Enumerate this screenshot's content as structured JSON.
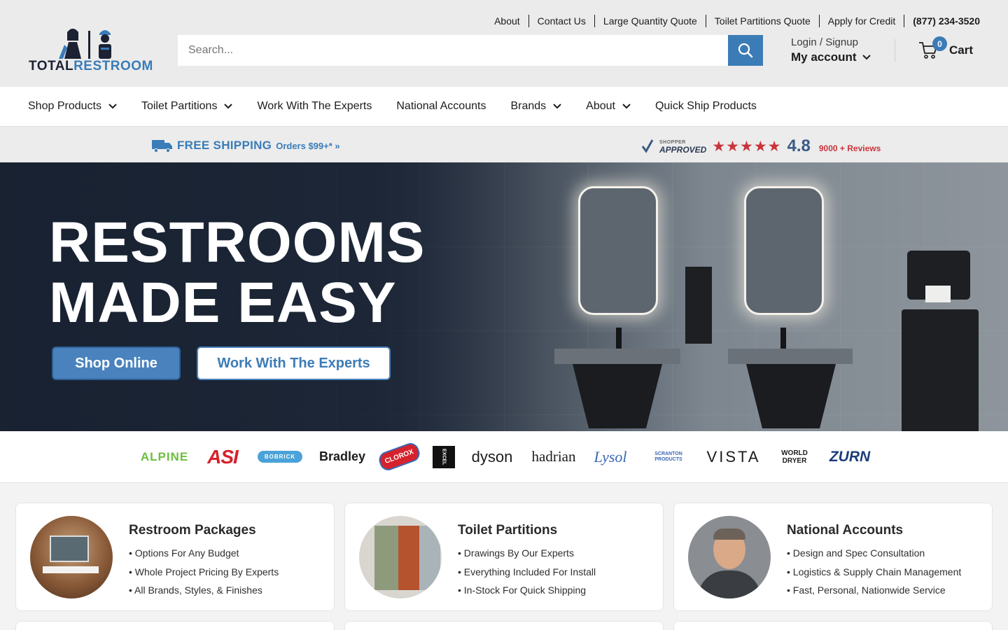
{
  "top_links": [
    "About",
    "Contact Us",
    "Large Quantity Quote",
    "Toilet Partitions Quote",
    "Apply for Credit",
    "(877) 234-3520"
  ],
  "logo": {
    "part1": "TOTAL",
    "part2": "RESTROOM"
  },
  "search": {
    "placeholder": "Search..."
  },
  "account": {
    "login": "Login / Signup",
    "my_account": "My account"
  },
  "cart": {
    "count": "0",
    "label": "Cart"
  },
  "nav": [
    {
      "label": "Shop Products",
      "dropdown": true
    },
    {
      "label": "Toilet Partitions",
      "dropdown": true
    },
    {
      "label": "Work With The Experts",
      "dropdown": false
    },
    {
      "label": "National Accounts",
      "dropdown": false
    },
    {
      "label": "Brands",
      "dropdown": true
    },
    {
      "label": "About",
      "dropdown": true
    },
    {
      "label": "Quick Ship Products",
      "dropdown": false
    }
  ],
  "promo": {
    "shipping_big": "FREE SHIPPING",
    "shipping_small": "Orders $99+* »",
    "approved_small": "SHOPPER",
    "approved_big": "APPROVED",
    "stars": "★★★★★",
    "rating": "4.8",
    "reviews": "9000 + Reviews"
  },
  "hero": {
    "title_line1": "RESTROOMS",
    "title_line2": "MADE EASY",
    "btn_primary": "Shop Online",
    "btn_secondary": "Work With The Experts"
  },
  "brands": [
    "ALPINE",
    "ASI",
    "BOBRICK",
    "Bradley",
    "CLOROX",
    "EXCEL",
    "dyson",
    "hadrian",
    "Lysol",
    "SCRANTON PRODUCTS",
    "VISTA",
    "WORLD DRYER",
    "ZURN"
  ],
  "cards": [
    {
      "title": "Restroom Packages",
      "items": [
        "• Options For Any Budget",
        "• Whole Project Pricing By Experts",
        "• All Brands, Styles, & Finishes"
      ]
    },
    {
      "title": "Toilet Partitions",
      "items": [
        "• Drawings By Our Experts",
        "• Everything Included For Install",
        "• In-Stock For Quick Shipping"
      ]
    },
    {
      "title": "National Accounts",
      "items": [
        "• Design and Spec Consultation",
        "• Logistics & Supply Chain Management",
        "• Fast, Personal, Nationwide Service"
      ]
    }
  ],
  "colors": {
    "accent": "#3c7cb6",
    "star": "#c9343b",
    "header_bg": "#ebebeb"
  }
}
